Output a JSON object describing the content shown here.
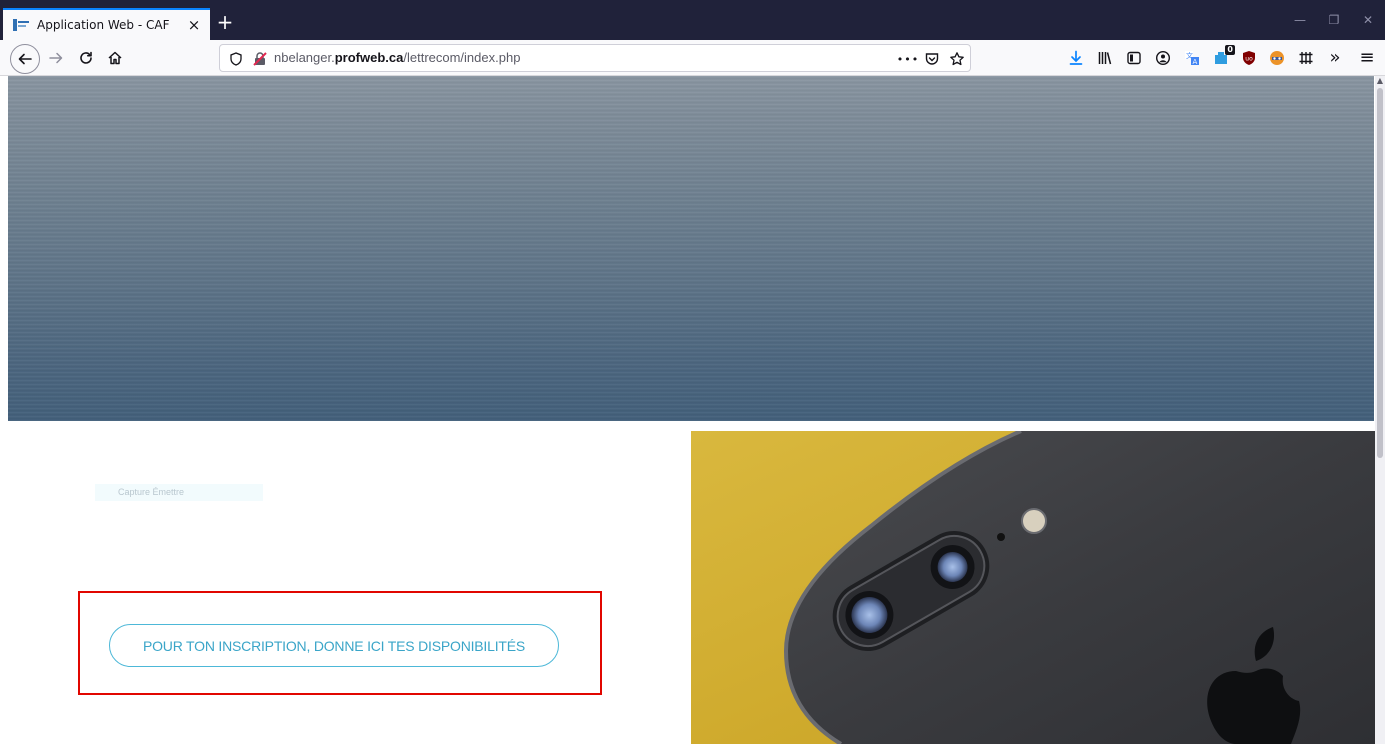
{
  "browser": {
    "tab": {
      "title": "Application Web - CAF",
      "close_label": "×"
    },
    "new_tab_label": "+",
    "window_controls": {
      "minimize": "—",
      "restore": "❐",
      "close": "✕"
    },
    "url": {
      "prefix": "nbelanger.",
      "host": "profweb.ca",
      "path": "/lettrecom/index.php"
    },
    "url_actions": {
      "more": "•••"
    },
    "extension_badge": "0",
    "overflow_label": "»",
    "menu_label": "≡"
  },
  "page": {
    "caption": "Capture Émettre",
    "cta_label": "POUR TON INSCRIPTION, DONNE ICI TES DISPONIBILITÉS"
  },
  "colors": {
    "tab_strip": "#20223a",
    "accent_tab": "#0a84ff",
    "cta": "#3aa5c8",
    "highlight": "#e10600",
    "photo_background": "#d3b23a"
  }
}
